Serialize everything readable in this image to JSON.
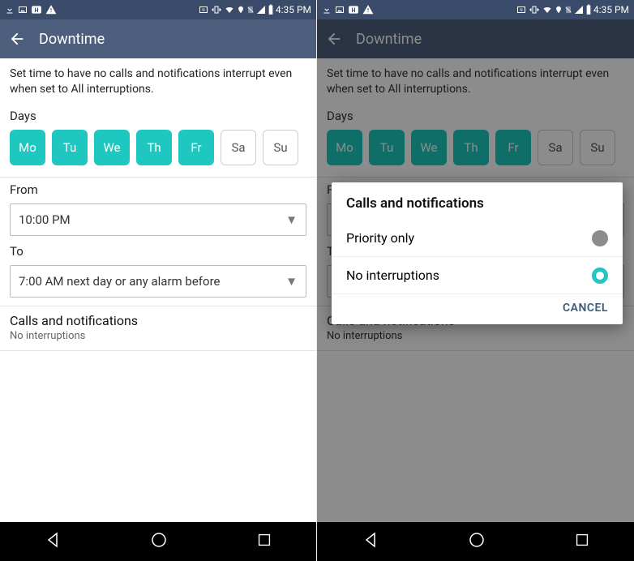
{
  "status": {
    "time": "4:35 PM",
    "icons_left": [
      "arrow-down-icon",
      "image-icon",
      "h-box-icon",
      "warning-icon"
    ],
    "icons_right": [
      "nfc-icon",
      "vibrate-icon",
      "wifi-icon",
      "location-icon",
      "no-sim-icon",
      "signal-icon",
      "battery-icon"
    ]
  },
  "appbar": {
    "title": "Downtime"
  },
  "intro": "Set time to have no calls and notifications interrupt even when set to All interruptions.",
  "days": {
    "label": "Days",
    "items": [
      {
        "abbr": "Mo",
        "selected": true
      },
      {
        "abbr": "Tu",
        "selected": true
      },
      {
        "abbr": "We",
        "selected": true
      },
      {
        "abbr": "Th",
        "selected": true
      },
      {
        "abbr": "Fr",
        "selected": true
      },
      {
        "abbr": "Sa",
        "selected": false
      },
      {
        "abbr": "Su",
        "selected": false
      }
    ]
  },
  "from": {
    "label": "From",
    "value": "10:00 PM"
  },
  "to": {
    "label": "To",
    "value": "7:00 AM next day or any alarm before"
  },
  "calls_section": {
    "title": "Calls and notifications",
    "value": "No interruptions"
  },
  "dialog": {
    "title": "Calls and notifications",
    "options": [
      {
        "label": "Priority only",
        "selected": false
      },
      {
        "label": "No interruptions",
        "selected": true
      }
    ],
    "cancel": "CANCEL"
  }
}
